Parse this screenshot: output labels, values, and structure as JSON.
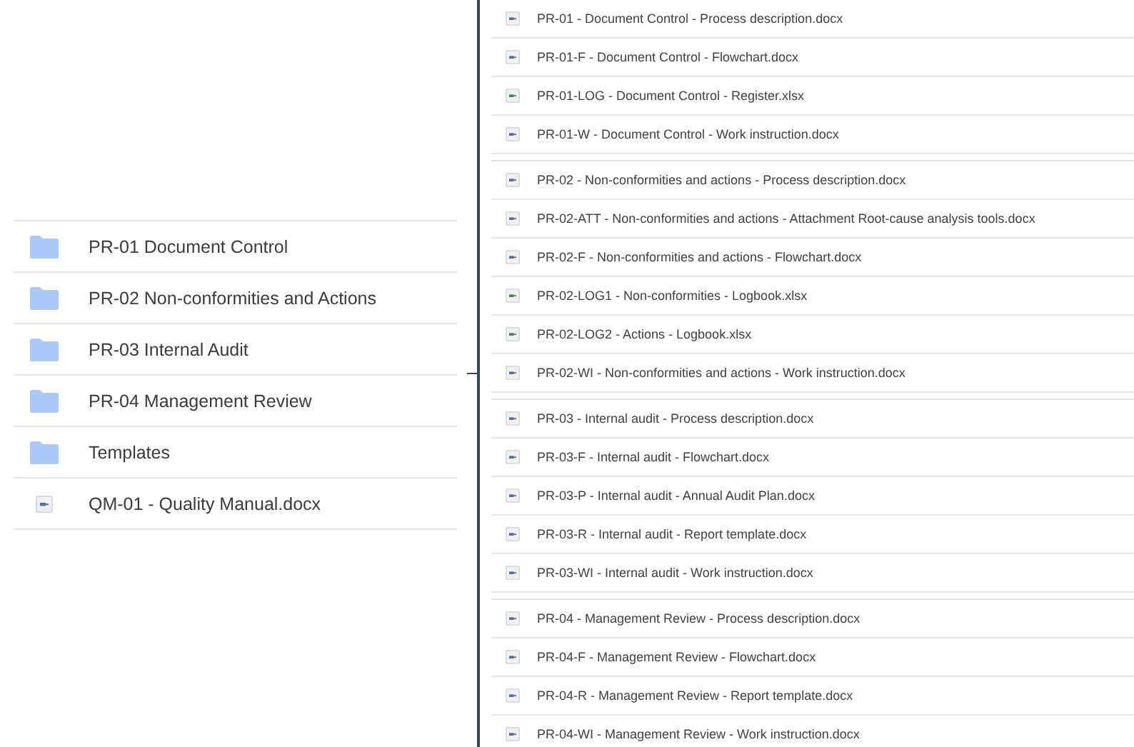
{
  "folder_list": [
    {
      "kind": "folder",
      "name": "PR-01 Document Control"
    },
    {
      "kind": "folder",
      "name": "PR-02 Non-conformities and Actions"
    },
    {
      "kind": "folder",
      "name": "PR-03 Internal Audit"
    },
    {
      "kind": "folder",
      "name": "PR-04 Management Review"
    },
    {
      "kind": "folder",
      "name": "Templates"
    },
    {
      "kind": "docx",
      "name": "QM-01 - Quality Manual.docx"
    }
  ],
  "file_groups": [
    {
      "files": [
        {
          "kind": "docx",
          "name": "PR-01 - Document Control - Process description.docx"
        },
        {
          "kind": "docx",
          "name": "PR-01-F - Document Control - Flowchart.docx"
        },
        {
          "kind": "xlsx",
          "name": "PR-01-LOG - Document Control - Register.xlsx"
        },
        {
          "kind": "docx",
          "name": "PR-01-W - Document Control - Work instruction.docx"
        }
      ]
    },
    {
      "files": [
        {
          "kind": "docx",
          "name": "PR-02 - Non-conformities and actions - Process description.docx"
        },
        {
          "kind": "docx",
          "name": "PR-02-ATT - Non-conformities and actions - Attachment Root-cause analysis tools.docx"
        },
        {
          "kind": "docx",
          "name": "PR-02-F - Non-conformities and actions - Flowchart.docx"
        },
        {
          "kind": "xlsx",
          "name": "PR-02-LOG1 - Non-conformities - Logbook.xlsx"
        },
        {
          "kind": "xlsx",
          "name": "PR-02-LOG2 - Actions - Logbook.xlsx"
        },
        {
          "kind": "docx",
          "name": "PR-02-WI - Non-conformities and actions - Work instruction.docx"
        }
      ]
    },
    {
      "files": [
        {
          "kind": "docx",
          "name": "PR-03 - Internal audit - Process description.docx"
        },
        {
          "kind": "docx",
          "name": "PR-03-F - Internal audit - Flowchart.docx"
        },
        {
          "kind": "docx",
          "name": "PR-03-P - Internal audit - Annual Audit Plan.docx"
        },
        {
          "kind": "docx",
          "name": "PR-03-R - Internal audit - Report template.docx"
        },
        {
          "kind": "docx",
          "name": "PR-03-WI - Internal audit - Work instruction.docx"
        }
      ]
    },
    {
      "files": [
        {
          "kind": "docx",
          "name": "PR-04 - Management Review - Process description.docx"
        },
        {
          "kind": "docx",
          "name": "PR-04-F - Management Review - Flowchart.docx"
        },
        {
          "kind": "docx",
          "name": "PR-04-R - Management Review - Report template.docx"
        },
        {
          "kind": "docx",
          "name": "PR-04-WI - Management Review - Work instruction.docx"
        }
      ]
    }
  ]
}
